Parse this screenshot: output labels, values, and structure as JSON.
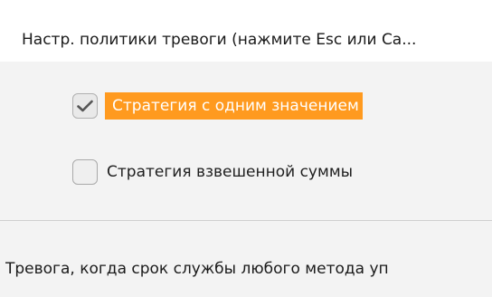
{
  "dialog": {
    "title": "Настр. политики тревоги (нажмите Esc или Ca..."
  },
  "options": [
    {
      "label": "Стратегия с одним значением",
      "checked": true,
      "highlighted": true
    },
    {
      "label": "Стратегия взвешенной суммы",
      "checked": false,
      "highlighted": false
    }
  ],
  "footer": {
    "text": "Тревога, когда срок службы любого метода уп"
  },
  "colors": {
    "highlight": "#ff9a1f",
    "header_bg": "#ffffff",
    "body_bg": "#f3f3f3"
  },
  "icons": {
    "checked": "checkmark-icon"
  }
}
